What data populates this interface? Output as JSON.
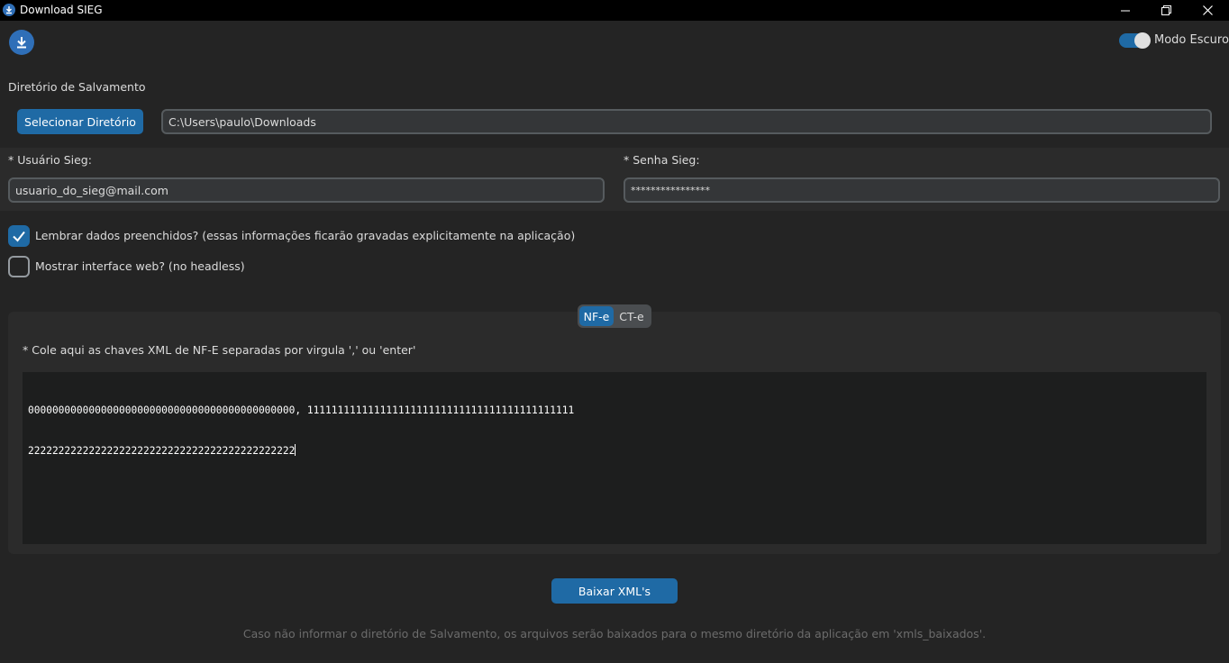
{
  "window": {
    "title": "Download SIEG",
    "minimize_glyph": "—",
    "maximize_glyph": "❐",
    "close_glyph": "✕"
  },
  "header": {
    "app_icon": "download-icon",
    "dark_mode_label": "Modo Escuro",
    "dark_mode_on": true
  },
  "directory": {
    "section_label": "Diretório de Salvamento",
    "select_button": "Selecionar Diretório",
    "path_value": "C:\\Users\\paulo\\Downloads"
  },
  "credentials": {
    "user_label": "* Usuário Sieg:",
    "user_value": "usuario_do_sieg@mail.com",
    "password_label": "* Senha Sieg:",
    "password_value": "****************"
  },
  "options": {
    "remember_label": "Lembrar dados preenchidos? (essas informações ficarão gravadas explicitamente na aplicação)",
    "remember_checked": true,
    "show_web_label": "Mostrar interface web? (no headless)",
    "show_web_checked": false
  },
  "tabs": {
    "items": [
      "NF-e",
      "CT-e"
    ],
    "active": "NF-e"
  },
  "nfe": {
    "instruction": "* Cole aqui as chaves XML de NF-E separadas por virgula ',' ou 'enter'",
    "line1": "00000000000000000000000000000000000000000000, 11111111111111111111111111111111111111111111",
    "line2": "22222222222222222222222222222222222222222222"
  },
  "actions": {
    "download_button": "Baixar XML's"
  },
  "footer": {
    "note": "Caso não informar o diretório de Salvamento, os arquivos serão baixados para o mesmo diretório da aplicação em 'xmls_baixados'."
  },
  "colors": {
    "accent": "#1f6aa5",
    "background": "#242424",
    "panel": "#2b2b2b"
  }
}
